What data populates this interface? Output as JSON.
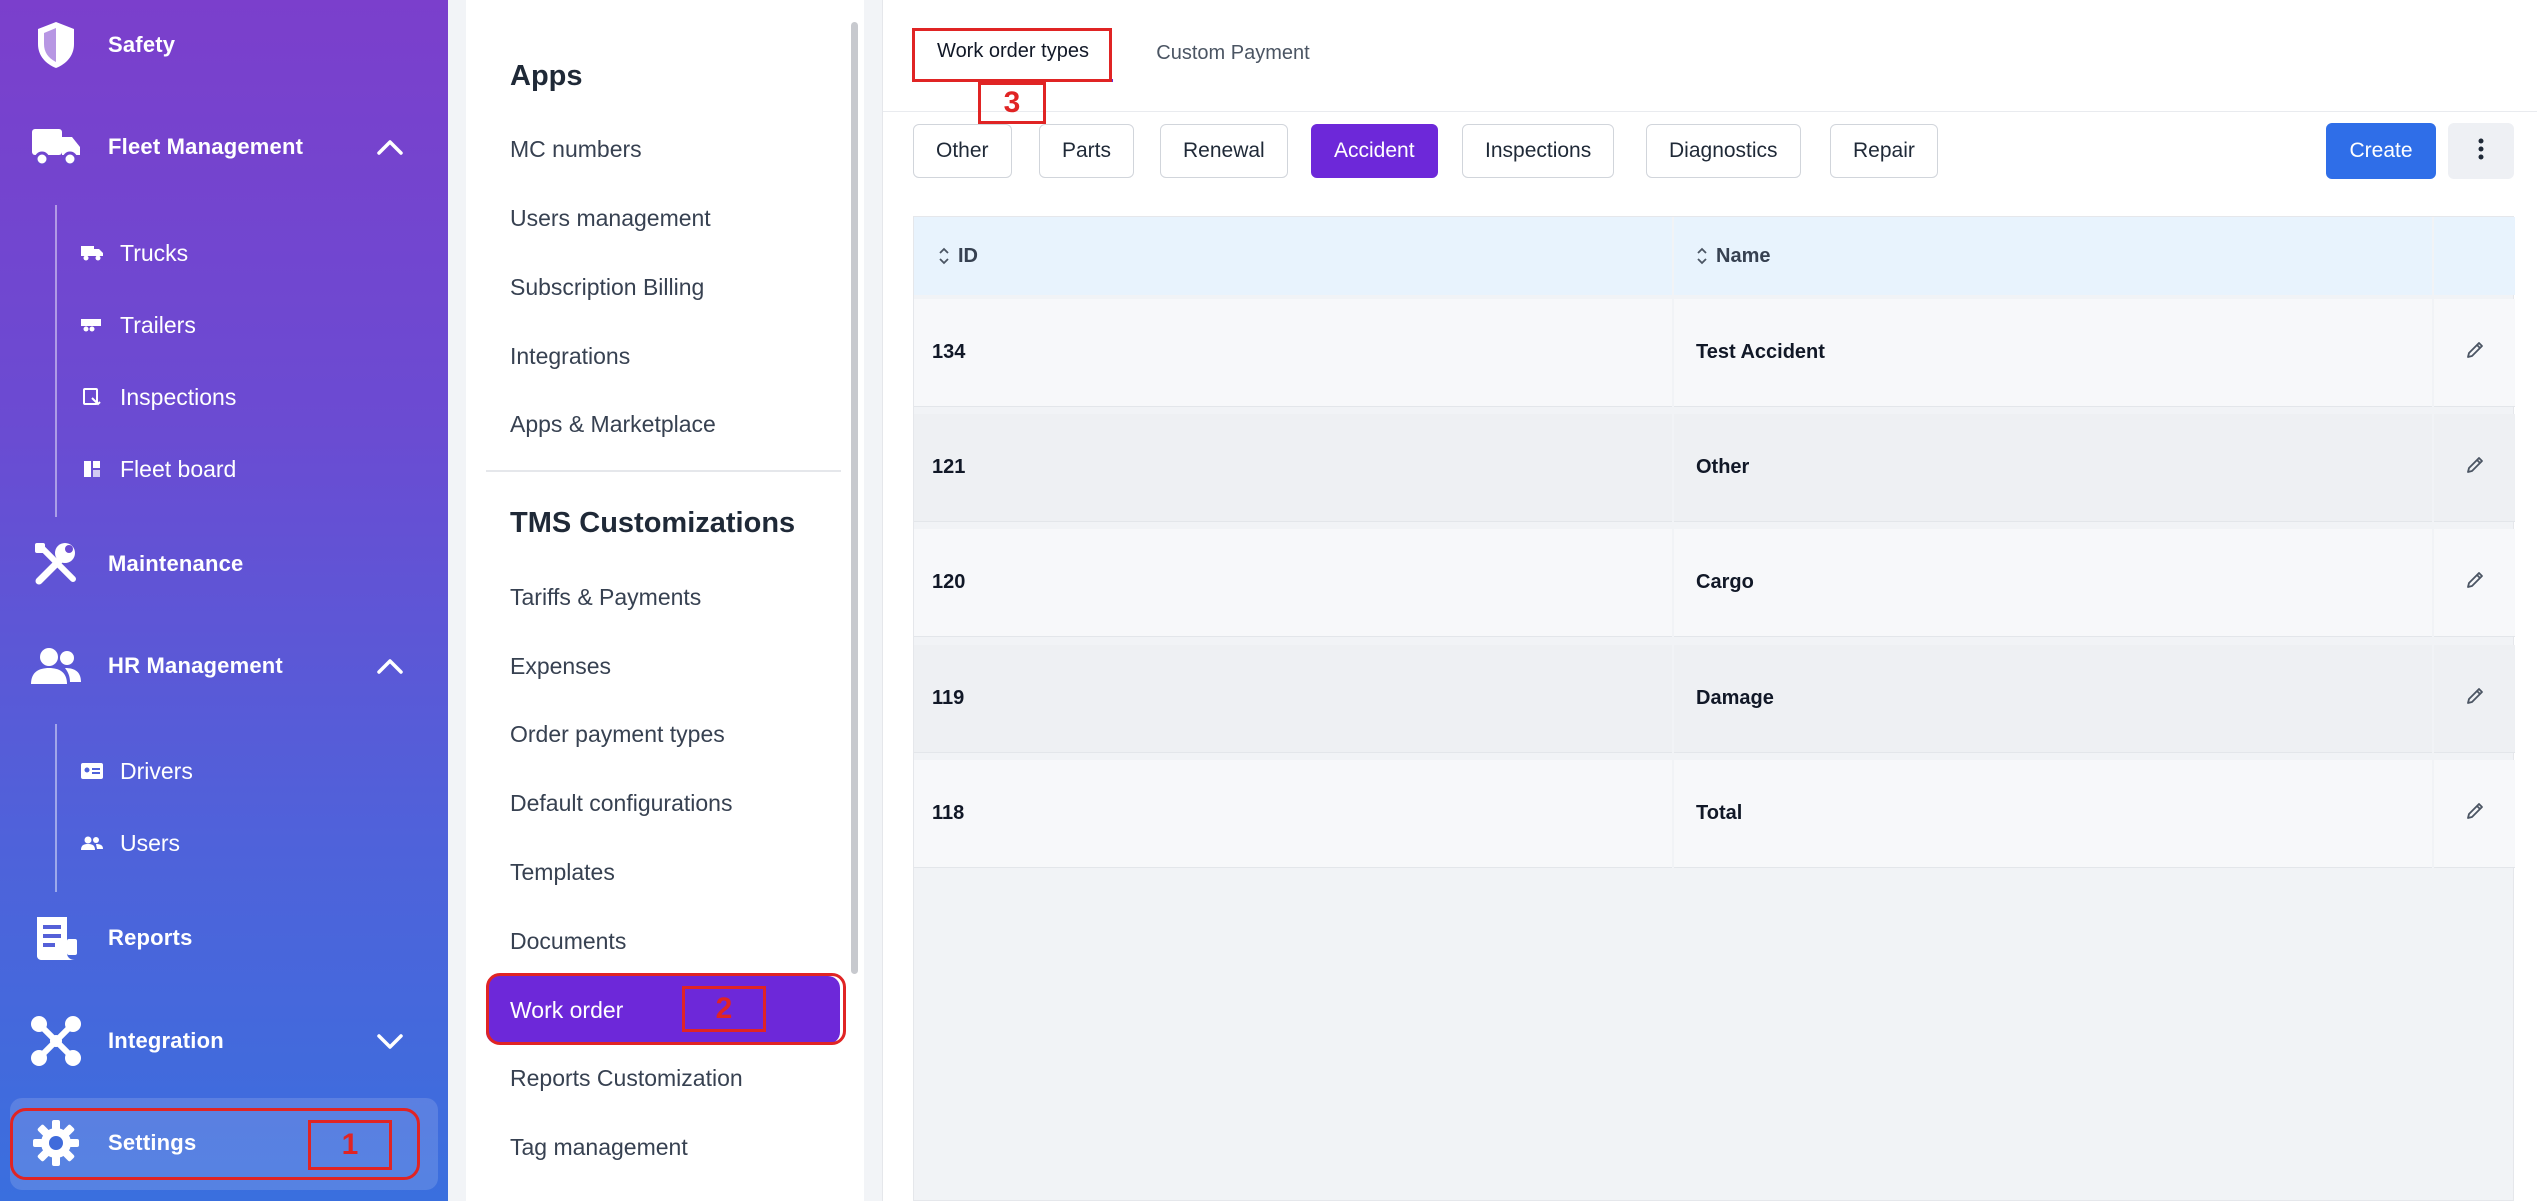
{
  "nav": {
    "safety": "Safety",
    "fleet_management": "Fleet Management",
    "fleet_sub": [
      "Trucks",
      "Trailers",
      "Inspections",
      "Fleet board"
    ],
    "maintenance": "Maintenance",
    "hr_management": "HR Management",
    "hr_sub": [
      "Drivers",
      "Users"
    ],
    "reports": "Reports",
    "integration": "Integration",
    "settings": "Settings"
  },
  "menu": {
    "apps_heading": "Apps",
    "apps_items": [
      "MC numbers",
      "Users management",
      "Subscription Billing",
      "Integrations",
      "Apps & Marketplace"
    ],
    "tms_heading": "TMS Customizations",
    "tms_items": [
      "Tariffs & Payments",
      "Expenses",
      "Order payment types",
      "Default configurations",
      "Templates",
      "Documents"
    ],
    "active_item": "Work order",
    "after_items": [
      "Reports Customization",
      "Tag management"
    ]
  },
  "tabs": {
    "work_order_types": "Work order types",
    "custom_payment": "Custom Payment"
  },
  "filters": [
    "Other",
    "Parts",
    "Renewal",
    "Accident",
    "Inspections",
    "Diagnostics",
    "Repair"
  ],
  "active_filter": "Accident",
  "toolbar": {
    "create_label": "Create"
  },
  "table": {
    "columns": [
      "ID",
      "Name"
    ],
    "rows": [
      {
        "id": "134",
        "name": "Test Accident"
      },
      {
        "id": "121",
        "name": "Other"
      },
      {
        "id": "120",
        "name": "Cargo"
      },
      {
        "id": "119",
        "name": "Damage"
      },
      {
        "id": "118",
        "name": "Total"
      }
    ]
  },
  "annotations": [
    "1",
    "2",
    "3"
  ],
  "colors": {
    "accent": "#6d28d9",
    "primary_button": "#2f6ee8",
    "annotation": "#e02424",
    "header_row": "#e8f3fd"
  }
}
